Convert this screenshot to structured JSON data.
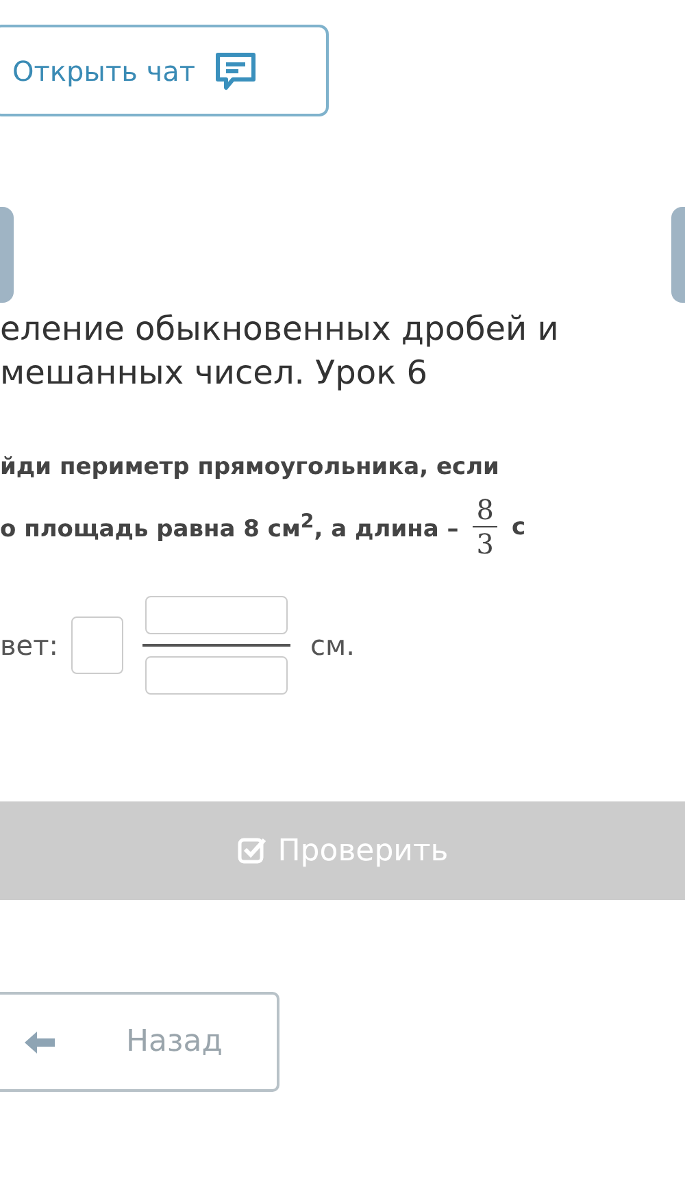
{
  "chat_button": {
    "label": "Открыть чат"
  },
  "title_lines": [
    "еление обыкновенных дробей и",
    "мешанных чисел. Урок 6"
  ],
  "question": {
    "line_1": "йди периметр прямоугольника, если",
    "line_2": "о площадь равна 8 см$^{2}$, а длина –",
    "fraction": {
      "numerator": "8",
      "denominator": "3"
    },
    "unit": "с"
  },
  "answer": {
    "label": "вет:",
    "unit": "см."
  },
  "check_button": {
    "label": "Проверить",
    "disabled": true
  },
  "back_button": {
    "label": "Назад"
  }
}
